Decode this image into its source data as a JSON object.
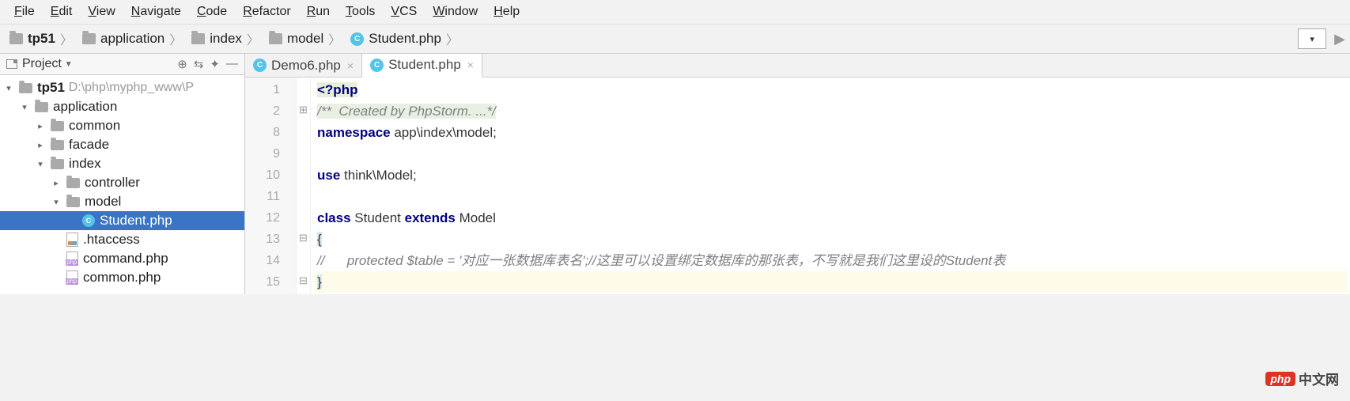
{
  "menu": [
    "File",
    "Edit",
    "View",
    "Navigate",
    "Code",
    "Refactor",
    "Run",
    "Tools",
    "VCS",
    "Window",
    "Help"
  ],
  "breadcrumbs": [
    {
      "type": "folder",
      "label": "tp51",
      "bold": true
    },
    {
      "type": "folder",
      "label": "application"
    },
    {
      "type": "folder",
      "label": "index"
    },
    {
      "type": "folder",
      "label": "model"
    },
    {
      "type": "php",
      "label": "Student.php"
    }
  ],
  "project": {
    "title": "Project",
    "root": {
      "name": "tp51",
      "path": "D:\\php\\myphp_www\\P"
    },
    "tree": [
      {
        "level": 1,
        "exp": "open",
        "type": "folder",
        "label": "application"
      },
      {
        "level": 2,
        "exp": "closed",
        "type": "folder",
        "label": "common"
      },
      {
        "level": 2,
        "exp": "closed",
        "type": "folder",
        "label": "facade"
      },
      {
        "level": 2,
        "exp": "open",
        "type": "folder",
        "label": "index"
      },
      {
        "level": 3,
        "exp": "closed",
        "type": "folder",
        "label": "controller"
      },
      {
        "level": 3,
        "exp": "open",
        "type": "folder",
        "label": "model"
      },
      {
        "level": 4,
        "exp": "none",
        "type": "phpclass",
        "label": "Student.php",
        "selected": true
      },
      {
        "level": 3,
        "exp": "none",
        "type": "htfile",
        "label": ".htaccess"
      },
      {
        "level": 3,
        "exp": "none",
        "type": "phpfile",
        "label": "command.php"
      },
      {
        "level": 3,
        "exp": "none",
        "type": "phpfile",
        "label": "common.php"
      }
    ]
  },
  "tabs": [
    {
      "label": "Demo6.php",
      "icon": "php",
      "active": false
    },
    {
      "label": "Student.php",
      "icon": "php",
      "active": true
    }
  ],
  "code": {
    "lines": [
      {
        "n": "1",
        "fold": "",
        "hl": false,
        "html": "<span class='tag'>&lt;?php</span>"
      },
      {
        "n": "2",
        "fold": "⊞",
        "hl": false,
        "html": "<span class='cmt cmt-bg'>/**  Created by PhpStorm. ...*/</span>"
      },
      {
        "n": "8",
        "fold": "",
        "hl": false,
        "html": "<span class='kw'>namespace</span> app\\index\\model;"
      },
      {
        "n": "9",
        "fold": "",
        "hl": false,
        "html": ""
      },
      {
        "n": "10",
        "fold": "",
        "hl": false,
        "html": "<span class='kw'>use</span> think\\Model;"
      },
      {
        "n": "11",
        "fold": "",
        "hl": false,
        "html": ""
      },
      {
        "n": "12",
        "fold": "",
        "hl": false,
        "html": "<span class='kw'>class</span> Student <span class='kw'>extends</span> Model"
      },
      {
        "n": "13",
        "fold": "⊟",
        "hl": false,
        "html": "<span class='brace'>{</span>"
      },
      {
        "n": "14",
        "fold": "",
        "hl": false,
        "html": "<span class='cmt'>//      protected $table = '对应一张数据库表名';//这里可以设置绑定数据库的那张表，不写就是我们这里设的Student表</span>"
      },
      {
        "n": "15",
        "fold": "⊟",
        "hl": true,
        "html": "<span class='brace'>}</span>"
      }
    ]
  },
  "watermark": {
    "logo": "php",
    "text": "中文网"
  }
}
